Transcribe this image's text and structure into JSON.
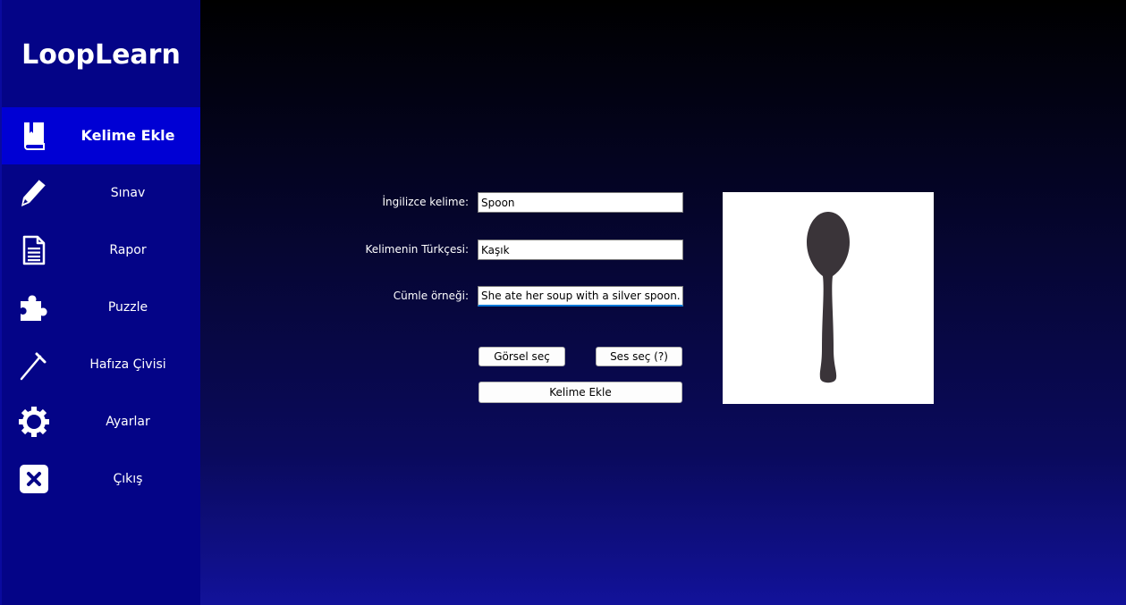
{
  "app": {
    "title": "LoopLearn"
  },
  "sidebar": {
    "items": [
      {
        "label": "Kelime Ekle",
        "icon": "book-icon",
        "active": true
      },
      {
        "label": "Sınav",
        "icon": "pencil-icon",
        "active": false
      },
      {
        "label": "Rapor",
        "icon": "document-icon",
        "active": false
      },
      {
        "label": "Puzzle",
        "icon": "puzzle-icon",
        "active": false
      },
      {
        "label": "Hafıza Çivisi",
        "icon": "nail-icon",
        "active": false
      },
      {
        "label": "Ayarlar",
        "icon": "gear-icon",
        "active": false
      },
      {
        "label": "Çıkış",
        "icon": "close-icon",
        "active": false
      }
    ]
  },
  "form": {
    "english_label": "İngilizce kelime:",
    "english_value": "Spoon",
    "turkish_label": "Kelimenin Türkçesi:",
    "turkish_value": "Kaşık",
    "sentence_label": "Cümle örneği:",
    "sentence_value": "She ate her soup with a silver spoon.",
    "select_image_label": "Görsel seç",
    "select_sound_label": "Ses seç (?)",
    "add_word_label": "Kelime Ekle"
  },
  "preview": {
    "image": "spoon-image"
  },
  "colors": {
    "sidebar_bg": "#040487",
    "sidebar_active": "#0000d4",
    "spoon": "#3a3439"
  }
}
